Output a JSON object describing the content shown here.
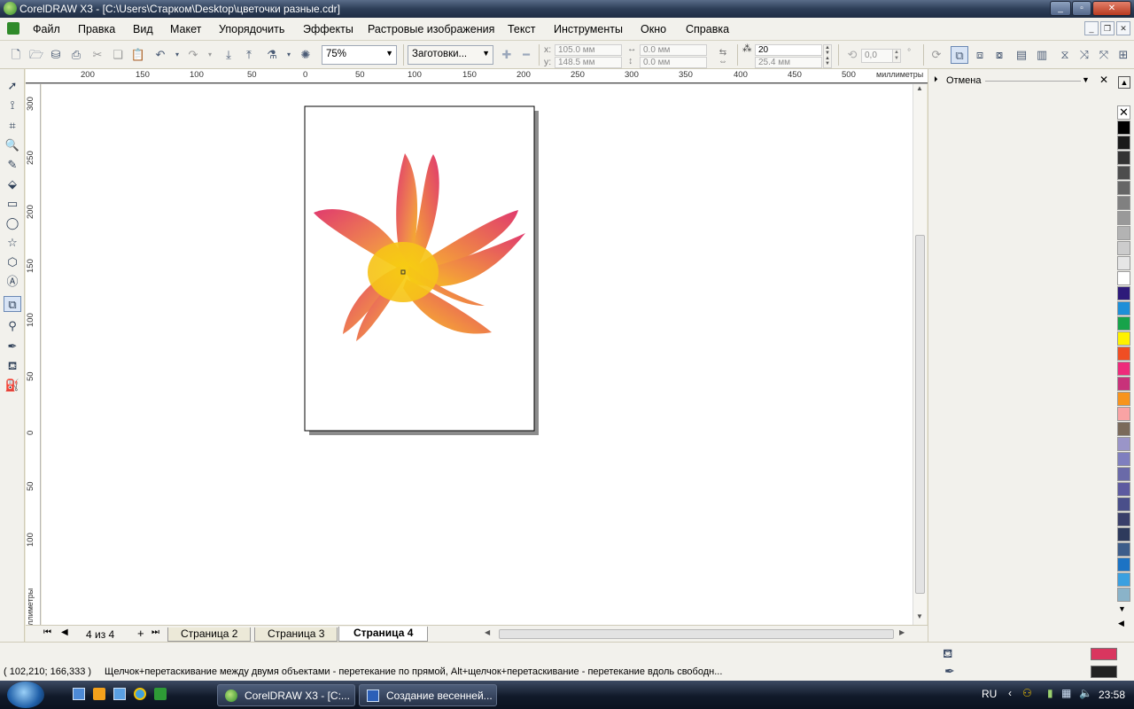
{
  "window": {
    "title": "CorelDRAW X3 - [C:\\Users\\Старком\\Desktop\\цветочки разные.cdr]",
    "minimize": "_",
    "maximize": "▫",
    "close": "✕"
  },
  "menu": {
    "items": [
      "Файл",
      "Правка",
      "Вид",
      "Макет",
      "Упорядочить",
      "Эффекты",
      "Растровые изображения",
      "Текст",
      "Инструменты",
      "Окно",
      "Справка"
    ]
  },
  "toolbar": {
    "zoom_value": "75%",
    "preset_value": "Заготовки...",
    "x_label": "x:",
    "x_value": "105.0 мм",
    "y_label": "y:",
    "y_value": "148.5 мм",
    "w_value": "0.0 мм",
    "h_value": "0.0 мм",
    "steps_value": "20",
    "spacing_value": "25.4 мм",
    "angle_value": "0,0",
    "angle_unit": "°"
  },
  "rulers": {
    "unit_label": "миллиметры",
    "h_ticks": [
      "200",
      "150",
      "100",
      "50",
      "0",
      "50",
      "100",
      "150",
      "200",
      "250",
      "300",
      "350",
      "400",
      "450",
      "500"
    ],
    "v_ticks": [
      "300",
      "250",
      "200",
      "150",
      "100",
      "50",
      "0",
      "50",
      "100"
    ],
    "v_unit_label": "миллиметры"
  },
  "docker": {
    "title": "Отмена"
  },
  "pages": {
    "counter": "4 из 4",
    "tabs": [
      "Страница 2",
      "Страница 3",
      "Страница 4"
    ],
    "active_tab": "Страница 4"
  },
  "status": {
    "coords": "( 102,210; 166,333 )",
    "hint": "Щелчок+перетаскивание между двумя объектами - перетекание по прямой, Alt+щелчок+перетаскивание - перетекание вдоль свободн..."
  },
  "fill_colors": {
    "fill": "#d9365f",
    "outline": "#222222"
  },
  "palette": [
    "#000000",
    "#1a1a1a",
    "#333333",
    "#4d4d4d",
    "#666666",
    "#808080",
    "#999999",
    "#b3b3b3",
    "#cccccc",
    "#e6e6e6",
    "#ffffff",
    "#2e1a7a",
    "#1e8fd8",
    "#17a34a",
    "#fff200",
    "#f04e23",
    "#ee2a7b",
    "#c8327a",
    "#f7941d",
    "#f9a3a4",
    "#7a6a5a",
    "#9a95c8",
    "#7f7fbf",
    "#6a6aa8",
    "#5d5aa0",
    "#4a4f8a",
    "#3a3f6a",
    "#2e3a5c",
    "#3d5d8a",
    "#1c73c4",
    "#3ba0e0",
    "#8ab3c9"
  ],
  "taskbar": {
    "tasks": [
      "CorelDRAW X3 - [C:...",
      "Создание весенней..."
    ],
    "language": "RU",
    "clock": "23:58"
  }
}
